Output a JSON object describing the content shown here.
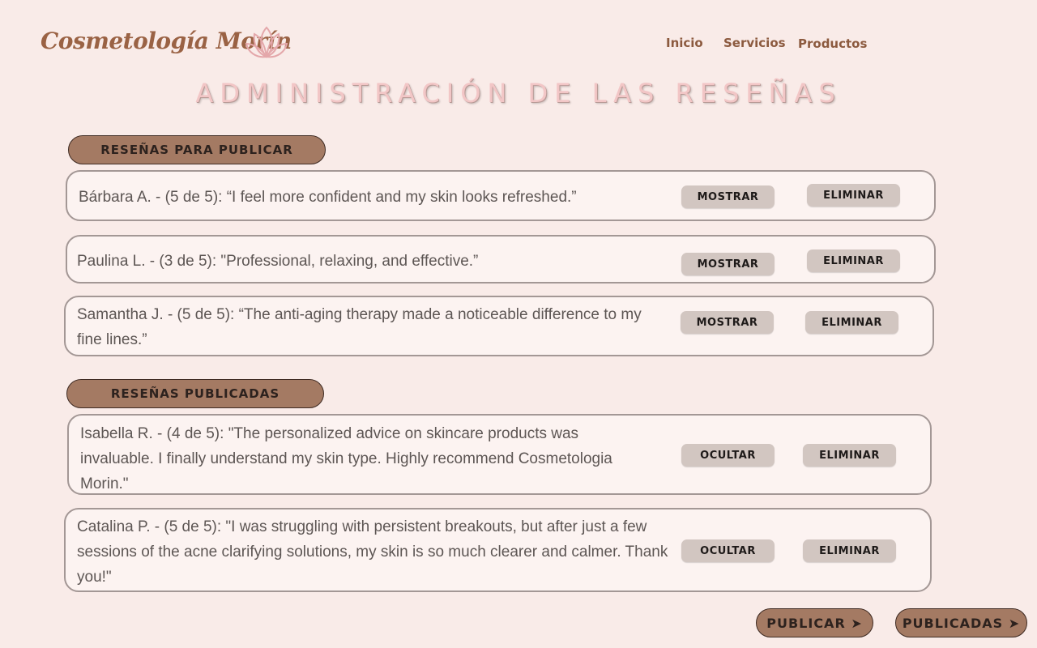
{
  "header": {
    "brand": "Cosmetología Morín",
    "logo_icon": "lotus-icon",
    "nav": [
      "Inicio",
      "Servicios",
      "Productos"
    ]
  },
  "page_title": "ADMINISTRACIÓN DE LAS RESEÑAS",
  "pending": {
    "heading": "RESEÑAS PARA PUBLICAR",
    "reviews": [
      {
        "text": "Bárbara A. - (5 de 5): “I feel more confident and my skin looks refreshed.”",
        "action": "MOSTRAR",
        "delete": "ELIMINAR"
      },
      {
        "text": "Paulina L. - (3 de 5): \"Professional, relaxing, and effective.”",
        "action": "MOSTRAR",
        "delete": "ELIMINAR"
      },
      {
        "text": "Samantha J. - (5 de 5): “The anti-aging therapy made a noticeable difference to my fine lines.”",
        "action": "MOSTRAR",
        "delete": "ELIMINAR"
      }
    ]
  },
  "published": {
    "heading": "RESEÑAS PUBLICADAS",
    "reviews": [
      {
        "text": "Isabella R. - (4 de 5): \"The personalized advice on skincare products was invaluable. I finally understand my skin type. Highly recommend Cosmetologia Morin.\"",
        "action": "OCULTAR",
        "delete": "ELIMINAR"
      },
      {
        "text": "Catalina P. - (5 de 5): \"I was struggling with persistent breakouts, but after just a few sessions of the acne clarifying solutions, my skin is so much clearer and calmer. Thank you!\"",
        "action": "OCULTAR",
        "delete": "ELIMINAR"
      }
    ]
  },
  "footer": {
    "publicar": "PUBLICAR ➤",
    "publicadas": "PUBLICADAS ➤"
  },
  "colors": {
    "background": "#f9ebe8",
    "brand": "#9a6244",
    "pill": "#a47a63",
    "button": "#d2c6c1"
  }
}
